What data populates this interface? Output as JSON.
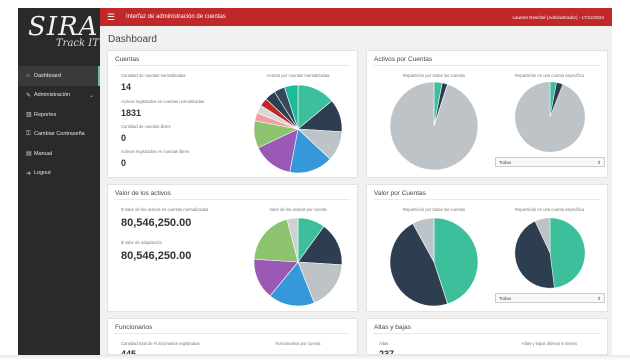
{
  "app": {
    "logo_main": "SIRA",
    "logo_sub": "Track IT"
  },
  "topbar": {
    "title": "Interfaz de administración de cuentas",
    "user": "Laurent Geschel (Administrador)  -  17/12/2024"
  },
  "sidebar": {
    "items": [
      {
        "label": "Dashboard",
        "icon": "home-icon",
        "glyph": "⌂"
      },
      {
        "label": "Administración",
        "icon": "tools-icon",
        "glyph": "✎"
      },
      {
        "label": "Reportes",
        "icon": "bar-chart-icon",
        "glyph": "▥"
      },
      {
        "label": "Cambiar Contraseña",
        "icon": "key-icon",
        "glyph": "⚿"
      },
      {
        "label": "Manual",
        "icon": "book-icon",
        "glyph": "▤"
      },
      {
        "label": "Logout",
        "icon": "logout-icon",
        "glyph": "➜"
      }
    ]
  },
  "page": {
    "title": "Dashboard"
  },
  "cuentas": {
    "title": "Cuentas",
    "l1": "Cantidad de cuentas normalizadas",
    "v1": "14",
    "l2": "Activos registrados en cuentas normalizadas",
    "v2": "1831",
    "l3": "Cantidad de cuentas libres",
    "v3": "0",
    "l4": "Activos registrados en cuentas libres",
    "v4": "0",
    "chart_caption": "Activos por cuentas normalizadas"
  },
  "activos_cuentas": {
    "title": "Activos por Cuentas",
    "cap1": "Repartición por todas las cuentas",
    "cap2": "Repartición en una cuenta específica",
    "select": "Todas"
  },
  "valor_activos": {
    "title": "Valor de los activos",
    "l1": "$ Valor de los activos en cuentas normalizadas",
    "v1": "80,546,250.00",
    "l2": "$ Valor de adquisición",
    "v2": "80,546,250.00",
    "chart_caption": "Valor de los activos por cuenta"
  },
  "valor_cuentas": {
    "title": "Valor por Cuentas",
    "cap1": "Repartición por todas las cuentas",
    "cap2": "Repartición en una cuenta específica",
    "select": "Todas"
  },
  "funcionarios": {
    "title": "Funcionarios",
    "l1": "Cantidad total de Funcionarios registrados",
    "chart_caption": "Funcionarios por cuenta",
    "v1": "445"
  },
  "altas": {
    "title": "Altas y bajas",
    "l1": "Altas",
    "l2": "Altas y bajas últimos 6 meses",
    "v1": "237"
  },
  "colors": {
    "accent": "#c0282a",
    "sidebar": "#2a2a2a",
    "teal": "#3dbf9c",
    "navy": "#2c3e50",
    "grey": "#bdc3c7",
    "blue": "#3498db",
    "purple": "#9b59b6",
    "green": "#8dc26f"
  },
  "pies": [
    {
      "id": "pie-cuentas",
      "slices": [
        {
          "v": 14,
          "c": "#3dbf9c"
        },
        {
          "v": 12,
          "c": "#2c3e50"
        },
        {
          "v": 11,
          "c": "#bdc3c7"
        },
        {
          "v": 16,
          "c": "#3498db"
        },
        {
          "v": 15,
          "c": "#9b59b6"
        },
        {
          "v": 10,
          "c": "#8dc26f"
        },
        {
          "v": 3,
          "c": "#f0a0a0"
        },
        {
          "v": 3,
          "c": "#d8d8d8"
        },
        {
          "v": 3,
          "c": "#c0282a"
        },
        {
          "v": 4,
          "c": "#2c3e50"
        },
        {
          "v": 4,
          "c": "#34495e"
        },
        {
          "v": 5,
          "c": "#1abc9c"
        }
      ]
    },
    {
      "id": "pie-activos-todas",
      "slices": [
        {
          "v": 3,
          "c": "#3dbf9c"
        },
        {
          "v": 2,
          "c": "#2c3e50"
        },
        {
          "v": 95,
          "c": "#bdc3c7"
        }
      ]
    },
    {
      "id": "pie-activos-especifica",
      "slices": [
        {
          "v": 3,
          "c": "#3dbf9c"
        },
        {
          "v": 3,
          "c": "#2c3e50"
        },
        {
          "v": 94,
          "c": "#bdc3c7"
        }
      ]
    },
    {
      "id": "pie-valor-activos",
      "slices": [
        {
          "v": 10,
          "c": "#3dbf9c"
        },
        {
          "v": 16,
          "c": "#2c3e50"
        },
        {
          "v": 18,
          "c": "#bdc3c7"
        },
        {
          "v": 17,
          "c": "#3498db"
        },
        {
          "v": 15,
          "c": "#9b59b6"
        },
        {
          "v": 20,
          "c": "#8dc26f"
        },
        {
          "v": 4,
          "c": "#d0d0d0"
        }
      ]
    },
    {
      "id": "pie-valor-todas",
      "slices": [
        {
          "v": 45,
          "c": "#3dbf9c"
        },
        {
          "v": 47,
          "c": "#2c3e50"
        },
        {
          "v": 8,
          "c": "#bdc3c7"
        }
      ]
    },
    {
      "id": "pie-valor-especifica",
      "slices": [
        {
          "v": 48,
          "c": "#3dbf9c"
        },
        {
          "v": 45,
          "c": "#2c3e50"
        },
        {
          "v": 7,
          "c": "#bdc3c7"
        }
      ]
    }
  ]
}
